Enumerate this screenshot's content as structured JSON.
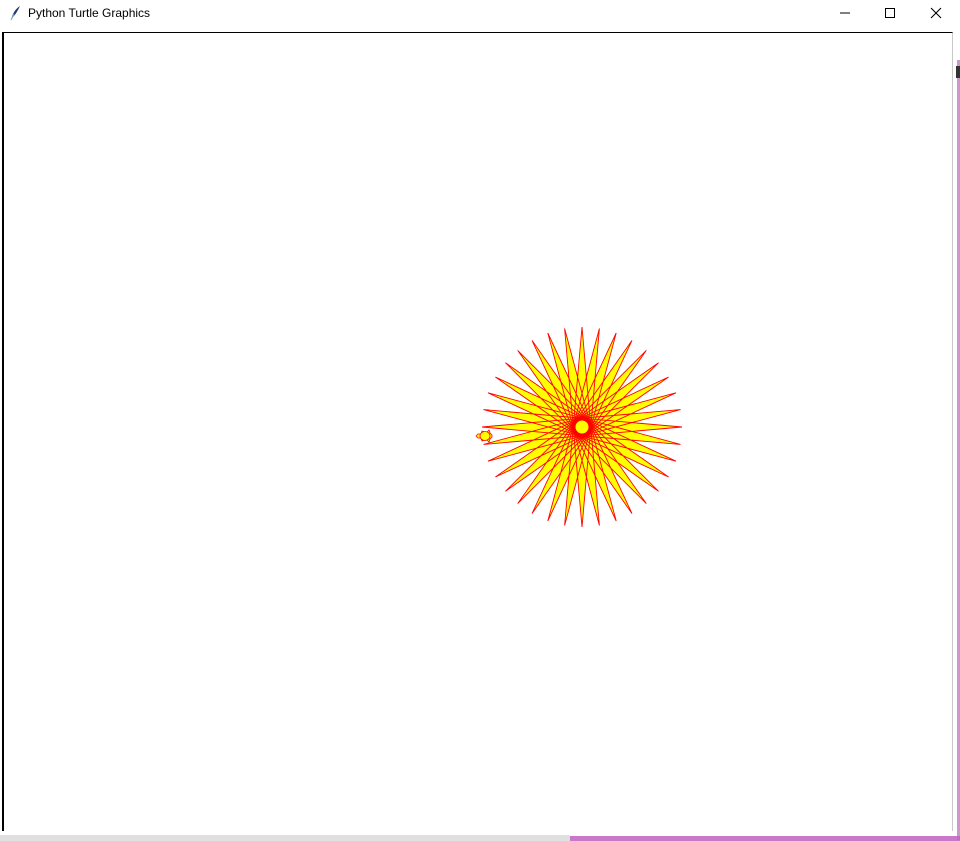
{
  "window": {
    "title": "Python Turtle Graphics",
    "icon": "feather-icon",
    "controls": [
      "minimize-icon",
      "maximize-icon",
      "close-icon"
    ]
  },
  "drawing": {
    "shape": "star",
    "points": 36,
    "pen_color": "#ff0000",
    "fill_color": "#ffff00",
    "turtle_shape": "turtle",
    "turtle_heading": "west"
  },
  "colors": {
    "canvas_background": "#ffffff",
    "titlebar_background": "#ffffff"
  }
}
